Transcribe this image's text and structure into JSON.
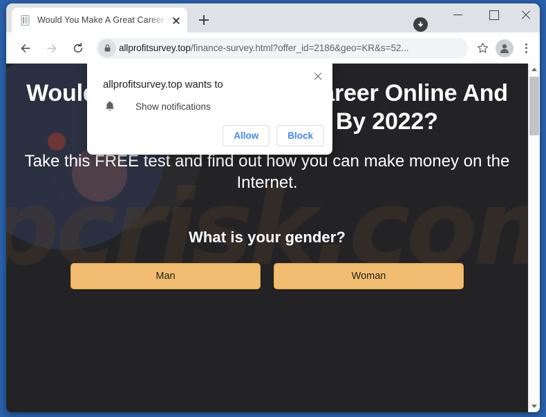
{
  "window": {
    "controls": {
      "minimize_label": "Minimize",
      "maximize_label": "Maximize",
      "close_label": "Close"
    }
  },
  "tabstrip": {
    "tab": {
      "title": "Would You Make A Great Career",
      "favicon": "document-icon",
      "close_label": "Close tab"
    },
    "new_tab_label": "New tab",
    "download_indicator": "download-icon"
  },
  "toolbar": {
    "back_label": "Back",
    "forward_label": "Forward",
    "reload_label": "Reload",
    "lock_icon": "lock-icon",
    "url_host": "allprofitsurvey.top",
    "url_path": "/finance-survey.html?offer_id=2186&geo=KR&s=52...",
    "url_full": "allprofitsurvey.top/finance-survey.html?offer_id=2186&geo=KR&s=52...",
    "bookmark_label": "Bookmark this tab",
    "profile_label": "Profile",
    "menu_label": "Customize and control Google Chrome"
  },
  "permission_dialog": {
    "title": "allprofitsurvey.top wants to",
    "icon": "bell-icon",
    "option": "Show notifications",
    "allow_label": "Allow",
    "block_label": "Block",
    "close_label": "Close"
  },
  "page": {
    "headline": "Would You Make A Great Career Online And Become A Millionaire By 2022?",
    "subheadline": "Take this FREE test and find out how you can make money on the Internet.",
    "question": "What is your gender?",
    "answers": [
      {
        "label": "Man"
      },
      {
        "label": "Woman"
      }
    ],
    "watermark": "pcrisk.com"
  },
  "scrollbar": {
    "up_label": "Scroll up",
    "down_label": "Scroll down",
    "thumb_label": "Scroll thumb"
  },
  "colors": {
    "page_background": "#232326",
    "answer_button": "#f2bd71",
    "link_blue": "#4285f4",
    "desktop": "#2a62ab",
    "tabstrip": "#dee1e6"
  }
}
